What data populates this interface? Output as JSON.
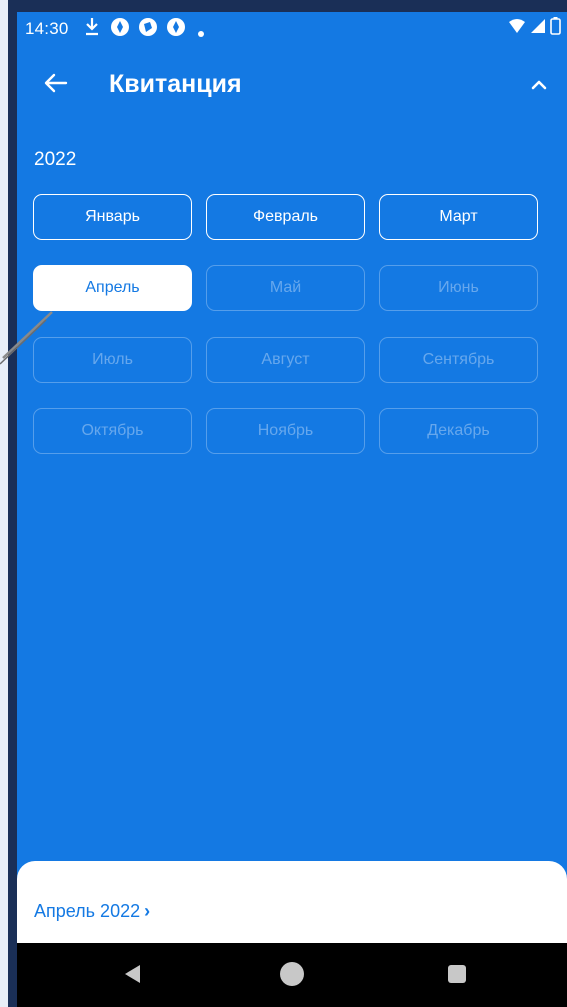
{
  "status_bar": {
    "time": "14:30",
    "icons": [
      "download-icon",
      "app-notification-icon",
      "app-notification-icon",
      "app-notification-icon",
      "dot-icon"
    ],
    "right_icons": [
      "wifi-icon",
      "cellular-signal-icon",
      "battery-icon"
    ]
  },
  "toolbar": {
    "title": "Квитанция",
    "back_icon": "arrow-left-icon",
    "collapse_icon": "chevron-up-icon"
  },
  "year": "2022",
  "months": [
    {
      "label": "Январь",
      "state": "enabled"
    },
    {
      "label": "Февраль",
      "state": "enabled"
    },
    {
      "label": "Март",
      "state": "enabled"
    },
    {
      "label": "Апрель",
      "state": "selected"
    },
    {
      "label": "Май",
      "state": "disabled"
    },
    {
      "label": "Июнь",
      "state": "disabled"
    },
    {
      "label": "Июль",
      "state": "disabled"
    },
    {
      "label": "Август",
      "state": "disabled"
    },
    {
      "label": "Сентябрь",
      "state": "disabled"
    },
    {
      "label": "Октябрь",
      "state": "disabled"
    },
    {
      "label": "Ноябрь",
      "state": "disabled"
    },
    {
      "label": "Декабрь",
      "state": "disabled"
    }
  ],
  "bottom_sheet": {
    "link_label": "Апрель 2022",
    "link_icon": "chevron-right-icon"
  },
  "nav_bar": {
    "icons": [
      "nav-back-icon",
      "nav-home-icon",
      "nav-recents-icon"
    ]
  },
  "colors": {
    "primary": "#1479e3",
    "surface": "#ffffff",
    "frame": "#1a2f57"
  }
}
